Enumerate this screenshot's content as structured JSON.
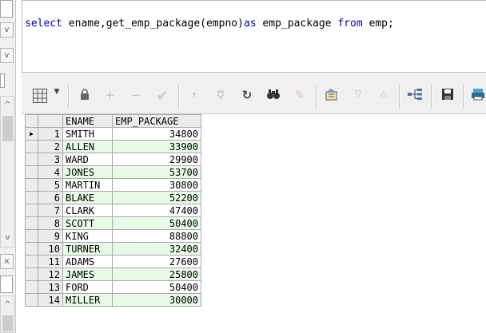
{
  "editor": {
    "sql": {
      "t1": "select",
      "t2": " ename,get_emp_package(empno)",
      "t3": "as",
      "t4": " emp_package ",
      "t5": "from",
      "t6": " emp;"
    }
  },
  "toolbar": {
    "icons": [
      "grid-menu-icon",
      "dropdown-arrow-icon",
      "lock-icon",
      "plus-icon",
      "minus-icon",
      "check-icon",
      "filter-down-icon",
      "filter-clear-icon",
      "refresh-icon",
      "find-icon",
      "clear-icon",
      "export-icon",
      "triangle-down-icon",
      "triangle-up-icon",
      "tree-icon",
      "save-icon",
      "print-icon"
    ]
  },
  "left_panel": {
    "arrows": {
      "up": "^",
      "down": "v",
      "down2": "v",
      "close": "×"
    }
  },
  "grid": {
    "columns": [
      "ENAME",
      "EMP_PACKAGE"
    ],
    "rows": [
      {
        "rn": "1",
        "ename": "SMITH",
        "pkg": "34800"
      },
      {
        "rn": "2",
        "ename": "ALLEN",
        "pkg": "33900"
      },
      {
        "rn": "3",
        "ename": "WARD",
        "pkg": "29900"
      },
      {
        "rn": "4",
        "ename": "JONES",
        "pkg": "53700"
      },
      {
        "rn": "5",
        "ename": "MARTIN",
        "pkg": "30800"
      },
      {
        "rn": "6",
        "ename": "BLAKE",
        "pkg": "52200"
      },
      {
        "rn": "7",
        "ename": "CLARK",
        "pkg": "47400"
      },
      {
        "rn": "8",
        "ename": "SCOTT",
        "pkg": "50400"
      },
      {
        "rn": "9",
        "ename": "KING",
        "pkg": "88800"
      },
      {
        "rn": "10",
        "ename": "TURNER",
        "pkg": "32400"
      },
      {
        "rn": "11",
        "ename": "ADAMS",
        "pkg": "27600"
      },
      {
        "rn": "12",
        "ename": "JAMES",
        "pkg": "25800"
      },
      {
        "rn": "13",
        "ename": "FORD",
        "pkg": "50400"
      },
      {
        "rn": "14",
        "ename": "MILLER",
        "pkg": "30000"
      }
    ],
    "alt_row_color": "#e7fbe7",
    "current_row_marker": "▶"
  }
}
